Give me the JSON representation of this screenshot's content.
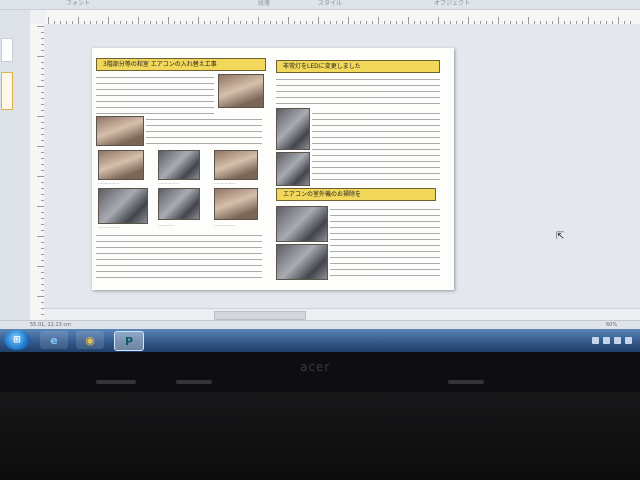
{
  "ribbon": {
    "groups": [
      "フォント",
      "段落",
      "スタイル",
      "オブジェクト"
    ]
  },
  "document": {
    "heading_1": "3階部分等の和室 エアコンの入れ替え工事",
    "heading_2": "非常灯をLEDに変更しました",
    "heading_3": "エアコンの室外機のお掃除を"
  },
  "status_bar": {
    "page_info": "",
    "coords": "55.01, 22.13 cm",
    "zoom": "60%"
  },
  "taskbar": {
    "start_label": "⊞",
    "apps": [
      {
        "name": "Internet Explorer",
        "glyph": "e"
      },
      {
        "name": "Google Chrome",
        "glyph": "◉"
      },
      {
        "name": "Microsoft Publisher",
        "glyph": "P"
      }
    ],
    "clock": ""
  },
  "hardware": {
    "brand": "acer"
  },
  "colors": {
    "heading_fill": "#f1d75a",
    "taskbar": "#34598a",
    "page_bg": "#fdfdfb"
  }
}
